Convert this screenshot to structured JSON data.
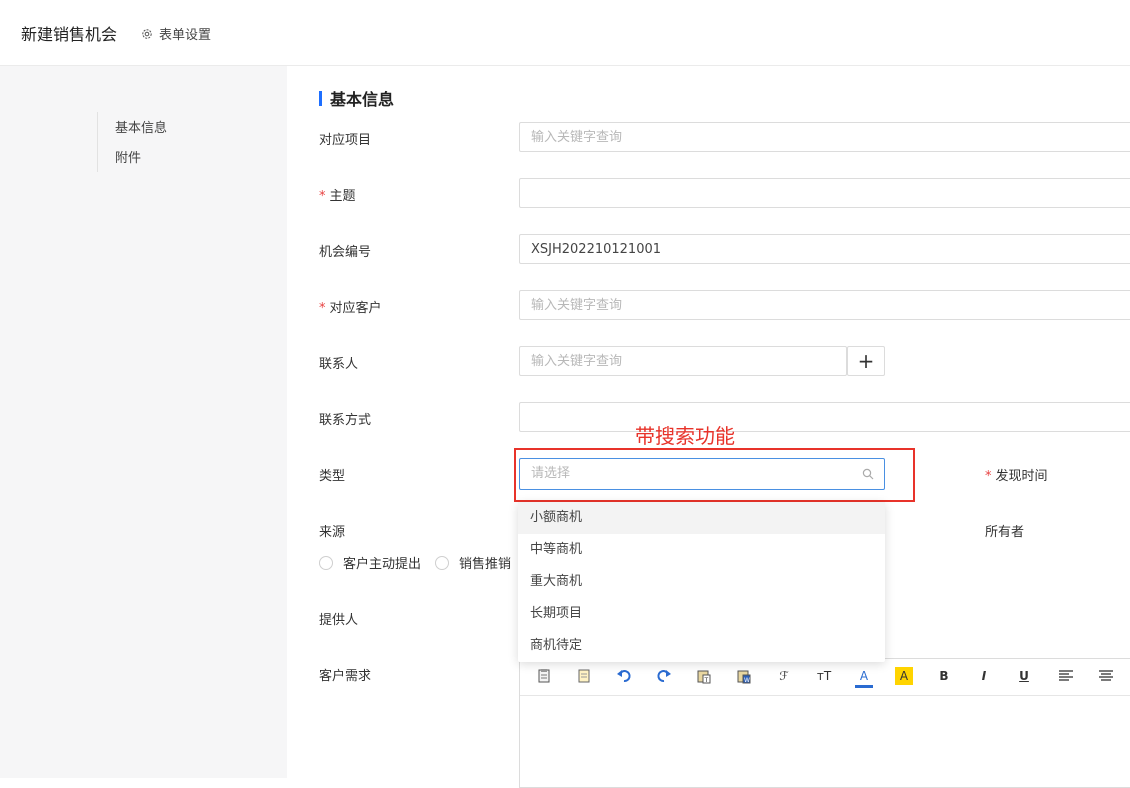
{
  "header": {
    "title": "新建销售机会",
    "form_settings": "表单设置"
  },
  "sidebar": {
    "items": [
      "基本信息",
      "附件"
    ]
  },
  "section": {
    "title": "基本信息"
  },
  "fields": {
    "project": {
      "label": "对应项目",
      "placeholder": "输入关键字查询"
    },
    "subject": {
      "label": "主题",
      "required": "*"
    },
    "number": {
      "label": "机会编号",
      "value": "XSJH202210121001"
    },
    "customer": {
      "label": "对应客户",
      "required": "*",
      "placeholder": "输入关键字查询"
    },
    "contact": {
      "label": "联系人",
      "placeholder": "输入关键字查询",
      "add": "+"
    },
    "contact_method": {
      "label": "联系方式"
    },
    "type": {
      "label": "类型",
      "placeholder": "请选择"
    },
    "discover_time": {
      "label": "发现时间",
      "required": "*"
    },
    "source": {
      "label": "来源",
      "options": [
        "客户主动提出",
        "销售推销"
      ]
    },
    "owner": {
      "label": "所有者"
    },
    "provider": {
      "label": "提供人"
    },
    "requirement": {
      "label": "客户需求"
    }
  },
  "annotation": {
    "text": "带搜索功能",
    "color": "#e8332a"
  },
  "dropdown": {
    "options": [
      "小额商机",
      "中等商机",
      "重大商机",
      "长期项目",
      "商机待定"
    ],
    "hovered_index": 0
  },
  "editor_toolbar": {
    "icons": [
      "clipboard-icon",
      "notebook-icon",
      "undo-icon",
      "redo-icon",
      "paste-text-icon",
      "paste-word-icon",
      "font-family-icon",
      "font-size-icon",
      "font-color-icon",
      "highlight-icon",
      "bold-icon",
      "italic-icon",
      "underline-icon",
      "align-left-icon",
      "align-center-icon"
    ],
    "labels": {
      "font_color": "A",
      "highlight": "A",
      "bold": "B",
      "italic": "I",
      "underline": "U",
      "font_size": "ᴛT",
      "font_family": "ℱ"
    }
  },
  "colors": {
    "accent": "#1e6fff",
    "required": "#e84040",
    "focus_border": "#4a90e2"
  }
}
